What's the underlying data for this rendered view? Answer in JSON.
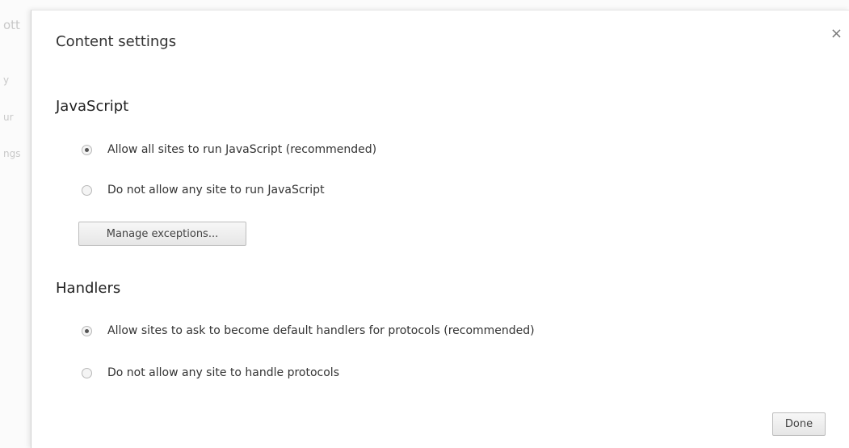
{
  "background": {
    "snippets": [
      "ott",
      "y",
      "ur",
      "ngs"
    ]
  },
  "dialog": {
    "title": "Content settings",
    "close_glyph": "×"
  },
  "javascript": {
    "heading": "JavaScript",
    "options": [
      {
        "label": "Allow all sites to run JavaScript (recommended)",
        "checked": true
      },
      {
        "label": "Do not allow any site to run JavaScript",
        "checked": false
      }
    ],
    "manage_button": "Manage exceptions..."
  },
  "handlers": {
    "heading": "Handlers",
    "options": [
      {
        "label": "Allow sites to ask to become default handlers for protocols (recommended)",
        "checked": true
      },
      {
        "label": "Do not allow any site to handle protocols",
        "checked": false
      }
    ]
  },
  "footer": {
    "done_label": "Done"
  }
}
